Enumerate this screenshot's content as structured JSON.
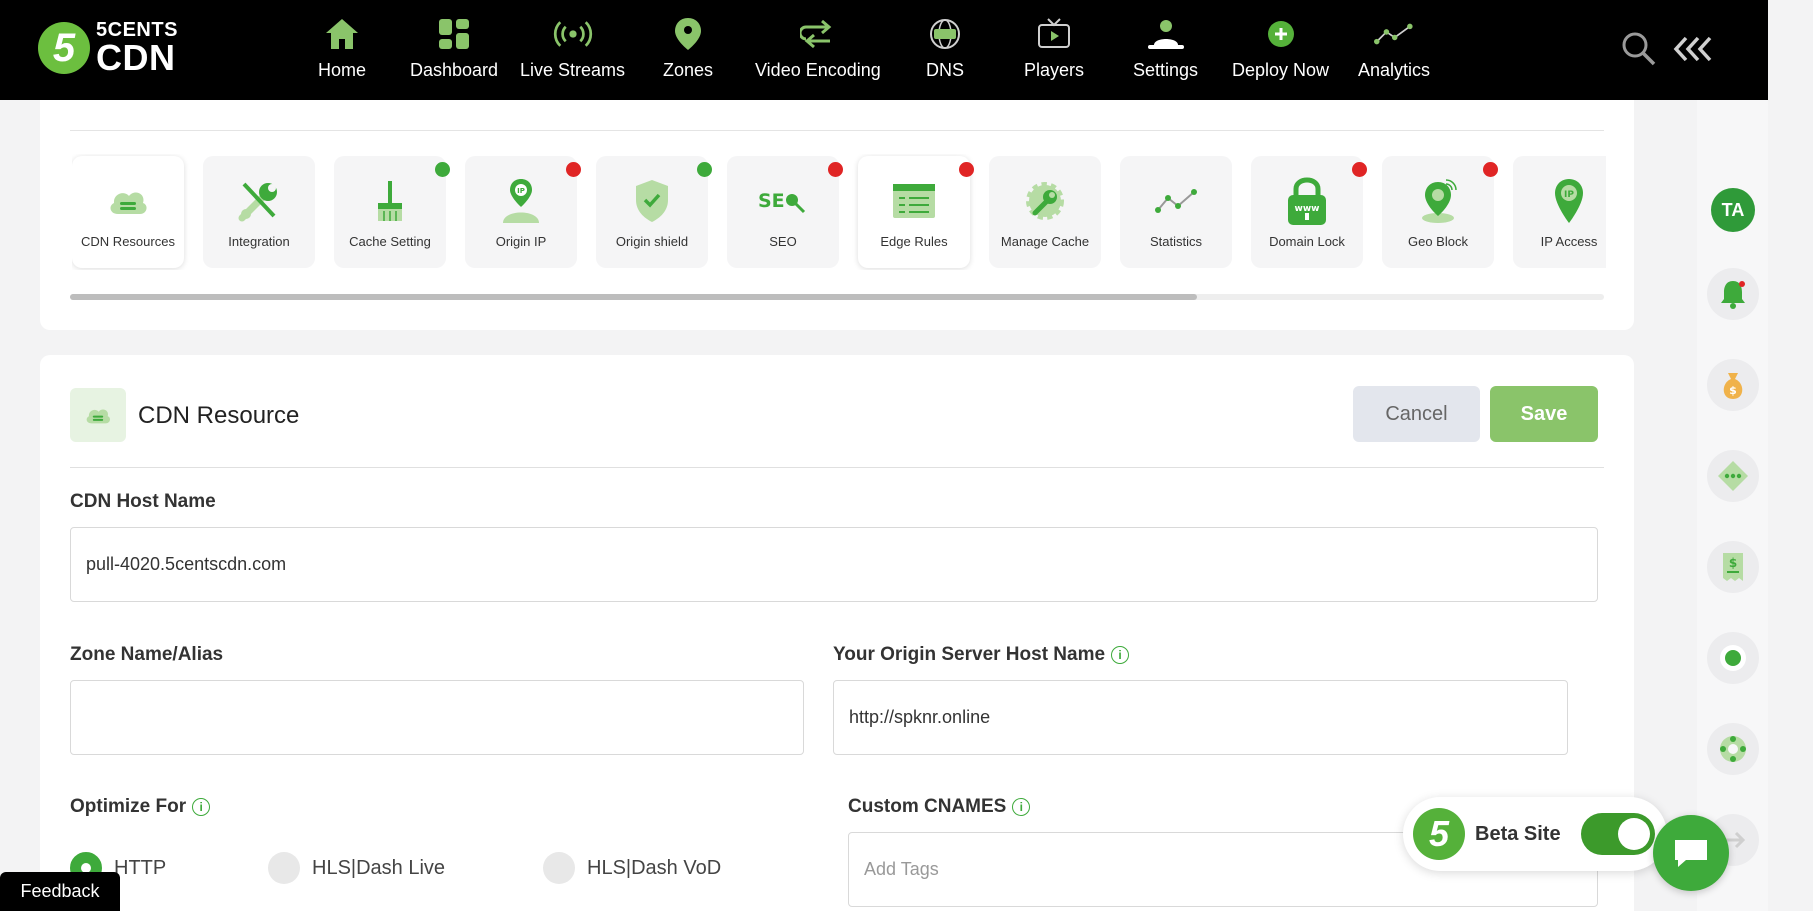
{
  "brand": {
    "line1": "5CENTS",
    "line2": "CDN",
    "mark": "5"
  },
  "nav": [
    {
      "label": "Home",
      "icon": "home-icon"
    },
    {
      "label": "Dashboard",
      "icon": "dashboard-icon"
    },
    {
      "label": "Live Streams",
      "icon": "broadcast-icon"
    },
    {
      "label": "Zones",
      "icon": "map-pin-icon"
    },
    {
      "label": "Video Encoding",
      "icon": "encoding-icon"
    },
    {
      "label": "DNS",
      "icon": "dns-globe-icon"
    },
    {
      "label": "Players",
      "icon": "tv-play-icon"
    },
    {
      "label": "Settings",
      "icon": "settings-user-icon"
    },
    {
      "label": "Deploy Now",
      "icon": "plus-circle-icon"
    },
    {
      "label": "Analytics",
      "icon": "analytics-line-icon"
    }
  ],
  "tiles": [
    {
      "label": "CDN Resources",
      "status": "none",
      "active": true
    },
    {
      "label": "Integration",
      "status": "none"
    },
    {
      "label": "Cache Setting",
      "status": "green"
    },
    {
      "label": "Origin IP",
      "status": "red"
    },
    {
      "label": "Origin shield",
      "status": "green"
    },
    {
      "label": "SEO",
      "status": "red"
    },
    {
      "label": "Edge Rules",
      "status": "red",
      "active": true
    },
    {
      "label": "Manage Cache",
      "status": "none"
    },
    {
      "label": "Statistics",
      "status": "none"
    },
    {
      "label": "Domain Lock",
      "status": "red"
    },
    {
      "label": "Geo Block",
      "status": "red"
    },
    {
      "label": "IP Access",
      "status": "none"
    }
  ],
  "tile_scroll_fraction": 0.735,
  "resource": {
    "title": "CDN Resource",
    "cancel_label": "Cancel",
    "save_label": "Save",
    "host_label": "CDN Host Name",
    "host_value": "pull-4020.5centscdn.com",
    "zone_label": "Zone Name/Alias",
    "zone_value": "",
    "origin_label": "Your Origin Server Host Name",
    "origin_value": "http://spknr.online",
    "optimize_label": "Optimize For",
    "optimize_options": [
      {
        "label": "HTTP",
        "selected": true
      },
      {
        "label": "HLS|Dash Live",
        "selected": false
      },
      {
        "label": "HLS|Dash VoD",
        "selected": false
      }
    ],
    "cnames_label": "Custom CNAMES",
    "cnames_placeholder": "Add Tags"
  },
  "user": {
    "initials": "TA"
  },
  "beta": {
    "label": "Beta Site",
    "enabled": true
  },
  "feedback_label": "Feedback",
  "colors": {
    "accent": "#3eaa3b",
    "accent_light": "#8ac46a",
    "topbar": "#000000",
    "status_red": "#e02525"
  }
}
